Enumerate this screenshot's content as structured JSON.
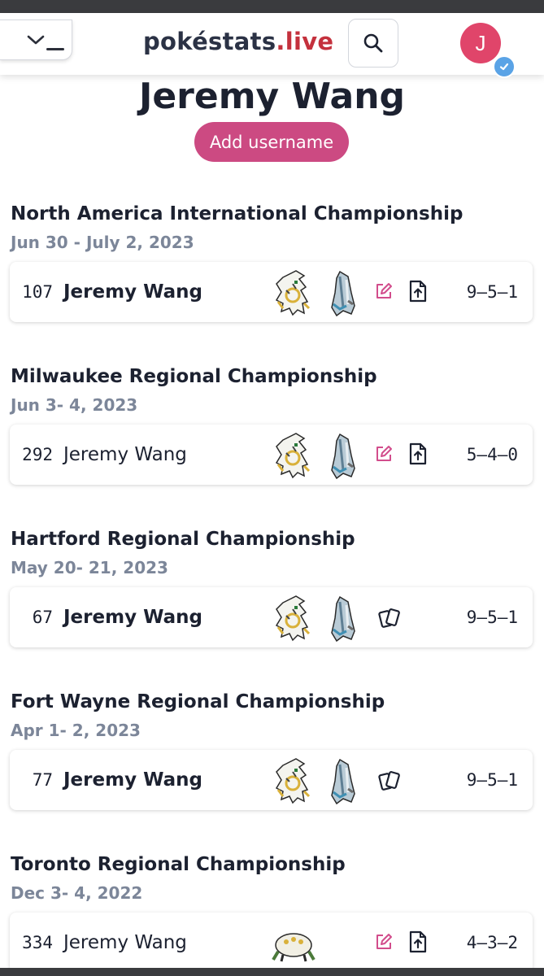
{
  "header": {
    "brand_main": "pokéstats",
    "brand_tld": ".live",
    "avatar_initial": "J",
    "colors": {
      "brand_text": "#2b3245",
      "brand_accent": "#c4313d",
      "avatar_bg": "#e0456a"
    }
  },
  "profile": {
    "name": "Jeremy Wang",
    "add_username_label": "Add username",
    "colors": {
      "button_bg": "#cc4a82"
    }
  },
  "tournaments": [
    {
      "title": "North America International Championship",
      "date": "Jun 30 - July 2, 2023",
      "placement": "107",
      "player": "Jeremy Wang",
      "record": "9–5–1",
      "sprites": [
        "arceus-sprite",
        "duraludon-sprite"
      ],
      "action_icons": [
        "edit-icon",
        "upload-icon"
      ]
    },
    {
      "title": "Milwaukee Regional Championship",
      "date": "Jun 3- 4, 2023",
      "placement": "292",
      "player": "Jeremy Wang",
      "record": "5–4–0",
      "sprites": [
        "arceus-sprite",
        "duraludon-sprite"
      ],
      "action_icons": [
        "edit-icon",
        "upload-icon"
      ]
    },
    {
      "title": "Hartford Regional Championship",
      "date": "May 20- 21, 2023",
      "placement": "67",
      "player": "Jeremy Wang",
      "record": "9–5–1",
      "sprites": [
        "arceus-sprite",
        "duraludon-sprite"
      ],
      "action_icons": [
        "cards-icon"
      ]
    },
    {
      "title": "Fort Wayne Regional Championship",
      "date": "Apr 1- 2, 2023",
      "placement": "77",
      "player": "Jeremy Wang",
      "record": "9–5–1",
      "sprites": [
        "arceus-sprite",
        "duraludon-sprite"
      ],
      "action_icons": [
        "cards-icon"
      ]
    },
    {
      "title": "Toronto Regional Championship",
      "date": "Dec 3- 4, 2022",
      "placement": "334",
      "player": "Jeremy Wang",
      "record": "4–3–2",
      "sprites": [
        "regigigas-sprite"
      ],
      "action_icons": [
        "edit-icon",
        "upload-icon"
      ]
    }
  ]
}
